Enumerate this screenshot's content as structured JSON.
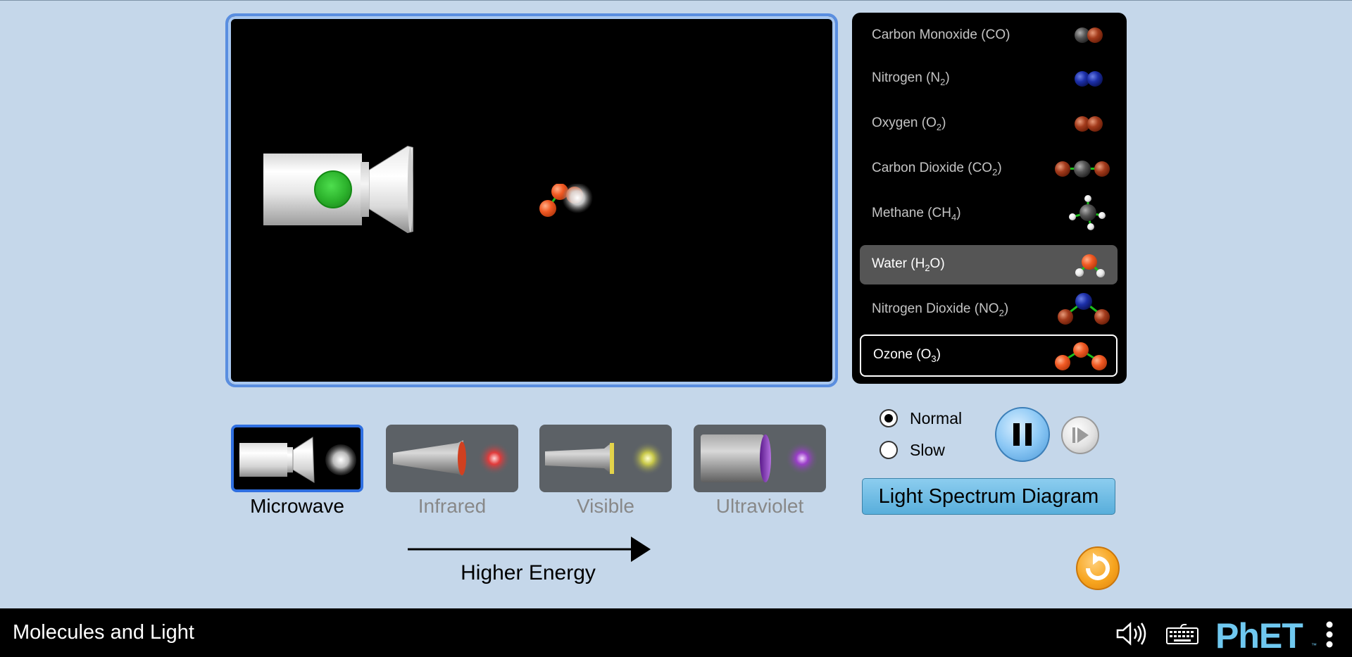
{
  "app": {
    "title": "Molecules and Light"
  },
  "molecules": [
    {
      "label": "Carbon Monoxide (CO)",
      "name": "Carbon Monoxide (",
      "formula": "CO",
      "sub": "",
      "tail": ")",
      "state": "normal"
    },
    {
      "label": "Nitrogen (N2)",
      "name": "Nitrogen (",
      "formula": "N",
      "sub": "2",
      "tail": ")",
      "state": "normal"
    },
    {
      "label": "Oxygen (O2)",
      "name": "Oxygen (",
      "formula": "O",
      "sub": "2",
      "tail": ")",
      "state": "normal"
    },
    {
      "label": "Carbon Dioxide (CO2)",
      "name": "Carbon Dioxide (",
      "formula": "CO",
      "sub": "2",
      "tail": ")",
      "state": "normal"
    },
    {
      "label": "Methane (CH4)",
      "name": "Methane (",
      "formula": "CH",
      "sub": "4",
      "tail": ")",
      "state": "normal"
    },
    {
      "label": "Water (H2O)",
      "name": "Water (",
      "formula": "H",
      "sub": "2",
      "tail": "O)",
      "state": "hover"
    },
    {
      "label": "Nitrogen Dioxide (NO2)",
      "name": "Nitrogen Dioxide (",
      "formula": "NO",
      "sub": "2",
      "tail": ")",
      "state": "normal"
    },
    {
      "label": "Ozone (O3)",
      "name": "Ozone (",
      "formula": "O",
      "sub": "3",
      "tail": ")",
      "state": "selected"
    }
  ],
  "light_sources": [
    {
      "label": "Microwave",
      "selected": true
    },
    {
      "label": "Infrared",
      "selected": false
    },
    {
      "label": "Visible",
      "selected": false
    },
    {
      "label": "Ultraviolet",
      "selected": false
    }
  ],
  "energy_label": "Higher Energy",
  "time_controls": {
    "normal_label": "Normal",
    "slow_label": "Slow",
    "selected": "Normal",
    "playing": true
  },
  "spectrum_button_label": "Light Spectrum Diagram",
  "colors": {
    "background": "#c5d7ea",
    "play_area_border": "#5a8ee0",
    "selected_source_border": "#2f6fe0",
    "emitter_button": "#2bb12b",
    "oxygen": "#f15a24",
    "carbon": "#555555",
    "nitrogen": "#1c2fa8",
    "hydrogen": "#ffffff"
  }
}
